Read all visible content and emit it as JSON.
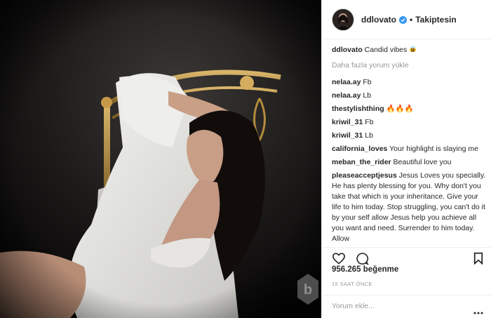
{
  "post": {
    "username": "ddlovato",
    "follow_status": "Takiptesin",
    "caption_user": "ddlovato",
    "caption_text": "Candid vibes",
    "caption_emoji": "bee-emoji",
    "load_more": "Daha fazla yorum yükle",
    "likes": "956.265 beğenme",
    "time": "15 SAAT ÖNCE",
    "add_comment_placeholder": "Yorum ekle..."
  },
  "comments": [
    {
      "user": "nelaa.ay",
      "text": "Fb"
    },
    {
      "user": "nelaa.ay",
      "text": "Lb"
    },
    {
      "user": "thestylishthing",
      "text": "🔥🔥🔥"
    },
    {
      "user": "kriwil_31",
      "text": "Fb"
    },
    {
      "user": "kriwil_31",
      "text": "Lb"
    },
    {
      "user": "california_loves",
      "text": "Your highlight is slaying me"
    },
    {
      "user": "meban_the_rider",
      "text": "Beautiful love you"
    },
    {
      "user": "pleaseacceptjesus",
      "text": "Jesus Loves you specially. He has plenty blessing for you. Why don't you take that which is your inheritance. Give your life to him today. Stop struggling, you can't do it by your self allow Jesus help you achieve all you want and need. Surrender to him today. Allow"
    }
  ],
  "icons": {
    "like": "heart-icon",
    "comment": "comment-bubble-icon",
    "save": "bookmark-icon",
    "verified": "verified-badge-icon",
    "options": "more-options-icon",
    "watermark": "watermark-b-logo"
  },
  "colors": {
    "accent_blue": "#3897f0",
    "muted_text": "#999999",
    "border": "#efefef"
  }
}
